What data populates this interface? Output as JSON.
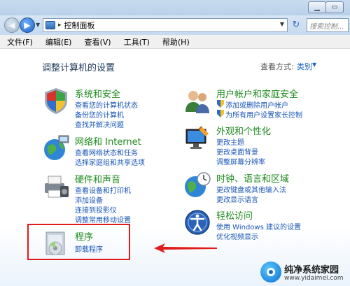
{
  "address": {
    "path": "控制面板",
    "search_placeholder": "搜索控制..."
  },
  "menu": [
    "文件(F)",
    "编辑(E)",
    "查看(V)",
    "工具(T)",
    "帮助(H)"
  ],
  "main": {
    "title": "调整计算机的设置",
    "view_by_label": "查看方式:",
    "view_by_value": "类别"
  },
  "categories": {
    "security": {
      "title": "系统和安全",
      "links": [
        "查看您的计算机状态",
        "备份您的计算机",
        "查找并解决问题"
      ]
    },
    "network": {
      "title": "网络和 Internet",
      "links": [
        "查看网络状态和任务",
        "选择家庭组和共享选项"
      ]
    },
    "hardware": {
      "title": "硬件和声音",
      "links": [
        "查看设备和打印机",
        "添加设备",
        "连接到投影仪",
        "调整常用移动设置"
      ]
    },
    "programs": {
      "title": "程序",
      "links": [
        "卸载程序"
      ]
    },
    "users": {
      "title": "用户帐户和家庭安全",
      "links": [
        "添加或删除用户帐户",
        "为所有用户设置家长控制"
      ]
    },
    "appearance": {
      "title": "外观和个性化",
      "links": [
        "更改主题",
        "更改桌面背景",
        "调整屏幕分辨率"
      ]
    },
    "clock": {
      "title": "时钟、语言和区域",
      "links": [
        "更改键盘或其他输入法",
        "更改显示语言"
      ]
    },
    "ease": {
      "title": "轻松访问",
      "links": [
        "使用 Windows 建议的设置",
        "优化视频显示"
      ]
    }
  },
  "watermark": {
    "name": "纯净系统家园",
    "url": "www.yidaimei.com"
  },
  "colors": {
    "category_title": "#1c8a1c",
    "link": "#1a56b8",
    "highlight": "#e11a1a"
  }
}
